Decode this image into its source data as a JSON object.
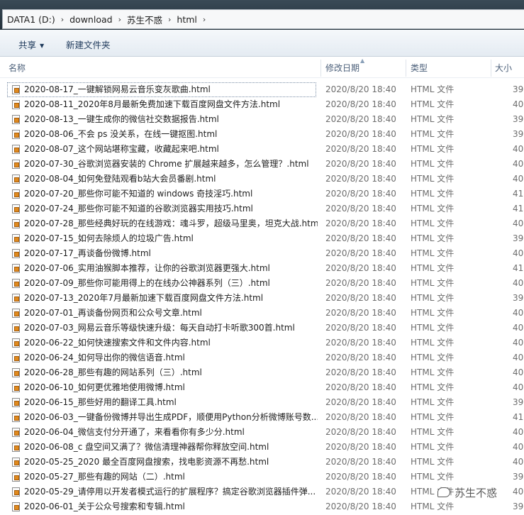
{
  "breadcrumb": [
    "DATA1 (D:)",
    "download",
    "苏生不惑",
    "html"
  ],
  "breadcrumb_sep": "›",
  "toolbar": {
    "share_label": "共享",
    "share_arrow": "▼",
    "new_folder_label": "新建文件夹"
  },
  "columns": {
    "name": "名称",
    "date": "修改日期",
    "type": "类型",
    "size": "大小"
  },
  "sort_indicator": "▲",
  "files": [
    {
      "name": "2020-08-17_一键解锁网易云音乐变灰歌曲.html",
      "date": "2020/8/20 18:40",
      "type": "HTML 文件",
      "size": "39"
    },
    {
      "name": "2020-08-11_2020年8月最新免费加速下载百度网盘文件方法.html",
      "date": "2020/8/20 18:40",
      "type": "HTML 文件",
      "size": "40"
    },
    {
      "name": "2020-08-13_一键生成你的微信社交数据报告.html",
      "date": "2020/8/20 18:40",
      "type": "HTML 文件",
      "size": "39"
    },
    {
      "name": "2020-08-06_不会 ps 没关系，在线一键抠图.html",
      "date": "2020/8/20 18:40",
      "type": "HTML 文件",
      "size": "39"
    },
    {
      "name": "2020-08-07_这个网站堪称宝藏，收藏起来吧.html",
      "date": "2020/8/20 18:40",
      "type": "HTML 文件",
      "size": "40"
    },
    {
      "name": "2020-07-30_谷歌浏览器安装的 Chrome 扩展越来越多，怎么管理？.html",
      "date": "2020/8/20 18:40",
      "type": "HTML 文件",
      "size": "40"
    },
    {
      "name": "2020-08-04_如何免登陆观看b站大会员番剧.html",
      "date": "2020/8/20 18:40",
      "type": "HTML 文件",
      "size": "40"
    },
    {
      "name": "2020-07-20_那些你可能不知道的 windows 奇技淫巧.html",
      "date": "2020/8/20 18:40",
      "type": "HTML 文件",
      "size": "41"
    },
    {
      "name": "2020-07-24_那些你可能不知道的谷歌浏览器实用技巧.html",
      "date": "2020/8/20 18:40",
      "type": "HTML 文件",
      "size": "41"
    },
    {
      "name": "2020-07-28_那些经典好玩的在线游戏：魂斗罗，超级马里奥，坦克大战.html",
      "date": "2020/8/20 18:40",
      "type": "HTML 文件",
      "size": "40"
    },
    {
      "name": "2020-07-15_如何去除烦人的垃圾广告.html",
      "date": "2020/8/20 18:40",
      "type": "HTML 文件",
      "size": "39"
    },
    {
      "name": "2020-07-17_再谈备份微博.html",
      "date": "2020/8/20 18:40",
      "type": "HTML 文件",
      "size": "40"
    },
    {
      "name": "2020-07-06_实用油猴脚本推荐，让你的谷歌浏览器更强大.html",
      "date": "2020/8/20 18:40",
      "type": "HTML 文件",
      "size": "41"
    },
    {
      "name": "2020-07-09_那些你可能用得上的在线办公神器系列（三）.html",
      "date": "2020/8/20 18:40",
      "type": "HTML 文件",
      "size": "40"
    },
    {
      "name": "2020-07-13_2020年7月最新加速下载百度网盘文件方法.html",
      "date": "2020/8/20 18:40",
      "type": "HTML 文件",
      "size": "39"
    },
    {
      "name": "2020-07-01_再谈备份网页和公众号文章.html",
      "date": "2020/8/20 18:40",
      "type": "HTML 文件",
      "size": "40"
    },
    {
      "name": "2020-07-03_网易云音乐等级快速升级：每天自动打卡听歌300首.html",
      "date": "2020/8/20 18:40",
      "type": "HTML 文件",
      "size": "40"
    },
    {
      "name": "2020-06-22_如何快速搜索文件和文件内容.html",
      "date": "2020/8/20 18:40",
      "type": "HTML 文件",
      "size": "40"
    },
    {
      "name": "2020-06-24_如何导出你的微信语音.html",
      "date": "2020/8/20 18:40",
      "type": "HTML 文件",
      "size": "40"
    },
    {
      "name": "2020-06-28_那些有趣的网站系列（三）.html",
      "date": "2020/8/20 18:40",
      "type": "HTML 文件",
      "size": "40"
    },
    {
      "name": "2020-06-10_如何更优雅地使用微博.html",
      "date": "2020/8/20 18:40",
      "type": "HTML 文件",
      "size": "40"
    },
    {
      "name": "2020-06-15_那些好用的翻译工具.html",
      "date": "2020/8/20 18:40",
      "type": "HTML 文件",
      "size": "39"
    },
    {
      "name": "2020-06-03_一键备份微博并导出生成PDF，顺便用Python分析微博账号数...",
      "date": "2020/8/20 18:40",
      "type": "HTML 文件",
      "size": "41"
    },
    {
      "name": "2020-06-04_微信支付分开通了，来看看你有多少分.html",
      "date": "2020/8/20 18:40",
      "type": "HTML 文件",
      "size": "40"
    },
    {
      "name": "2020-06-08_c 盘空间又满了？微信清理神器帮你释放空间.html",
      "date": "2020/8/20 18:40",
      "type": "HTML 文件",
      "size": "40"
    },
    {
      "name": "2020-05-25_2020 最全百度网盘搜索，找电影资源不再愁.html",
      "date": "2020/8/20 18:40",
      "type": "HTML 文件",
      "size": "40"
    },
    {
      "name": "2020-05-27_那些有趣的网站（二）.html",
      "date": "2020/8/20 18:40",
      "type": "HTML 文件",
      "size": "39"
    },
    {
      "name": "2020-05-29_请停用以开发者模式运行的扩展程序？搞定谷歌浏览器插件弹...",
      "date": "2020/8/20 18:40",
      "type": "HTML 文件",
      "size": "40"
    },
    {
      "name": "2020-06-01_关于公众号搜索和专辑.html",
      "date": "2020/8/20 18:40",
      "type": "HTML 文件",
      "size": "39"
    }
  ],
  "watermark": "苏生不惑"
}
